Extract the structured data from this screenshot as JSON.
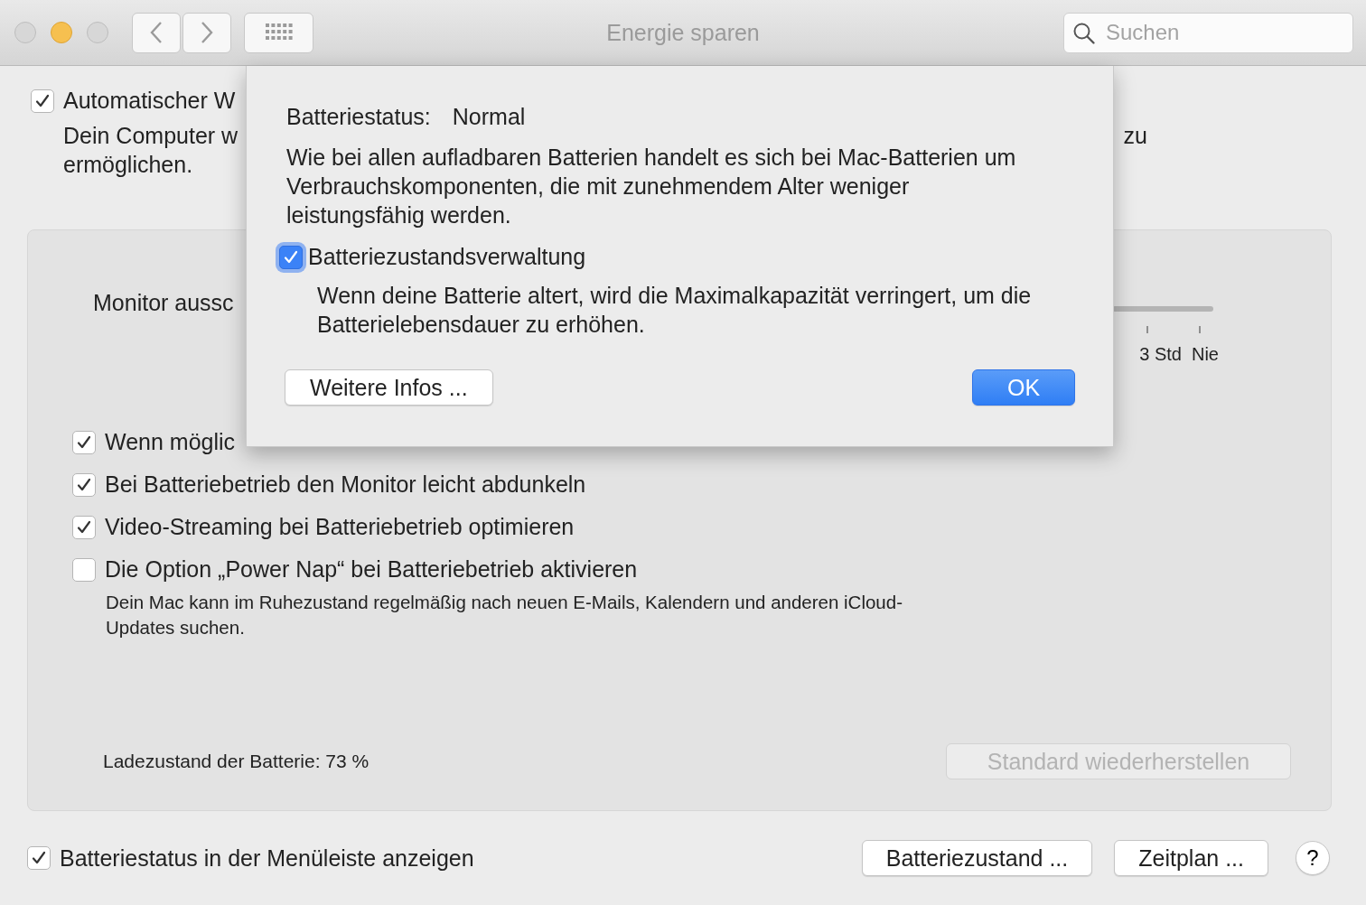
{
  "window": {
    "title": "Energie sparen"
  },
  "toolbar": {
    "search": {
      "placeholder": "Suchen"
    }
  },
  "background": {
    "auto_option": {
      "label": "Automatischer W",
      "checked": true
    },
    "auto_description": [
      "Dein Computer w",
      "ermöglichen."
    ],
    "auto_description_end": "zu"
  },
  "panel": {
    "slider": {
      "label": "Monitor aussc",
      "tick_labels": [
        "3 Std",
        "Nie"
      ]
    },
    "options": [
      {
        "label": "Wenn möglic",
        "checked": true
      },
      {
        "label": "Bei Batteriebetrieb den Monitor leicht abdunkeln",
        "checked": true
      },
      {
        "label": "Video-Streaming bei Batteriebetrieb optimieren",
        "checked": true
      },
      {
        "label": "Die Option „Power Nap“ bei Batteriebetrieb aktivieren",
        "checked": false
      }
    ],
    "power_nap_description": "Dein Mac kann im Ruhezustand regelmäßig nach neuen E-Mails, Kalendern und anderen iCloud-Updates suchen.",
    "battery_level": "Ladezustand der Batterie: 73 %",
    "restore_button": {
      "label": "Standard wiederherstellen",
      "disabled": true
    }
  },
  "footer": {
    "menu_bar_option": {
      "label": "Batteriestatus in der Menüleiste anzeigen",
      "checked": true
    },
    "buttons": [
      "Batteriezustand ...",
      "Zeitplan ..."
    ],
    "help": "?"
  },
  "sheet": {
    "status_label": "Batteriestatus:",
    "status_value": "Normal",
    "message": "Wie bei allen aufladbaren Batterien handelt es sich bei Mac-Batterien um Verbrauchskomponenten, die mit zunehmendem Alter weniger leistungsfähig werden.",
    "management": {
      "label": "Batteriezustandsverwaltung",
      "checked": true,
      "focused": true
    },
    "management_description": "Wenn deine Batterie altert, wird die Maximalkapazität verringert, um die Batterielebensdauer zu erhöhen.",
    "buttons": [
      {
        "label": "Weitere Infos ...",
        "default": false
      },
      {
        "label": "OK",
        "default": true
      }
    ]
  }
}
